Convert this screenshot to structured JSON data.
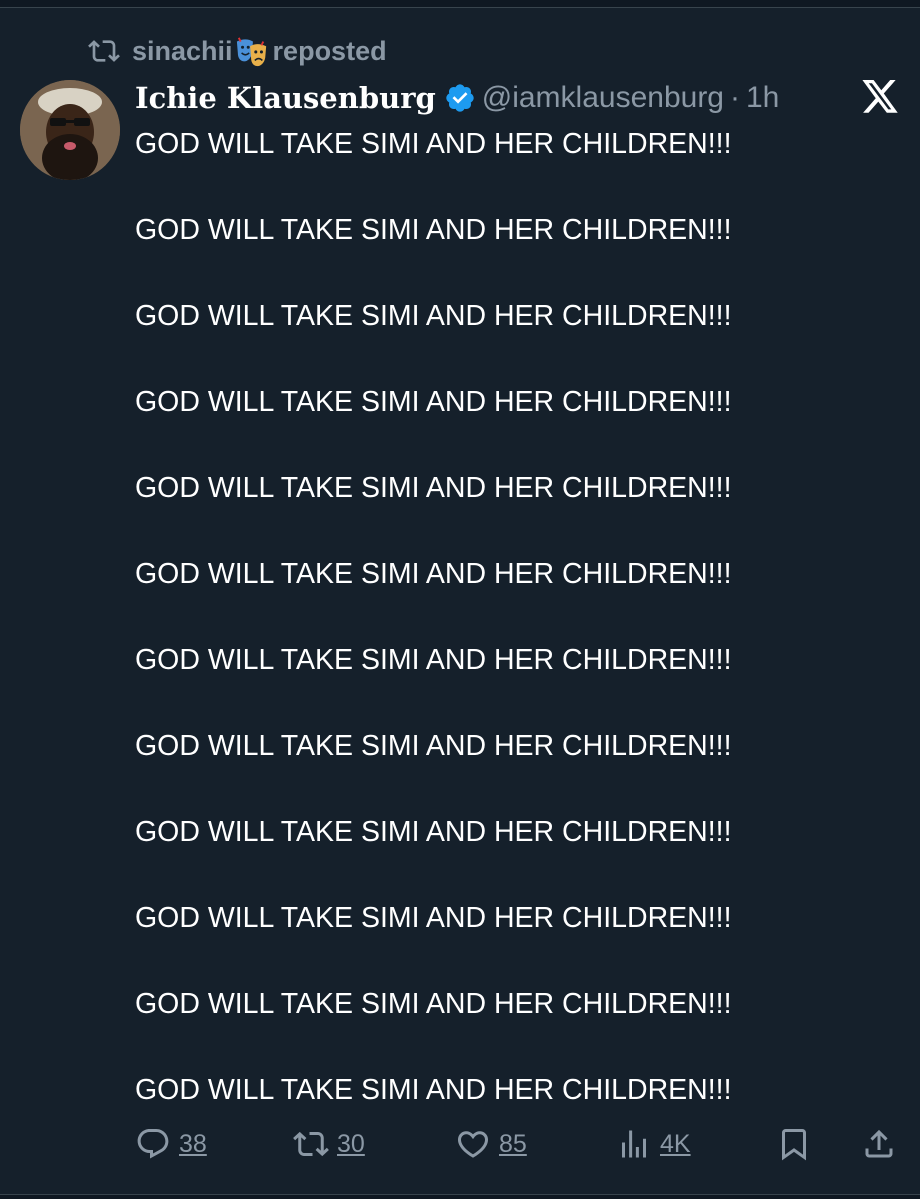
{
  "repost": {
    "reposter_name": "sinachii",
    "repost_label": "reposted",
    "mask_icon": "performing-arts-icon"
  },
  "tweet": {
    "display_name": "Ichie Klausenburg",
    "handle": "@iamklausenburg",
    "separator": "·",
    "time": "1h",
    "verified": true,
    "lines": [
      "GOD WILL TAKE SIMI AND HER CHILDREN!!!",
      "GOD WILL TAKE SIMI AND HER CHILDREN!!!",
      "GOD WILL TAKE SIMI AND HER CHILDREN!!!",
      "GOD WILL TAKE SIMI AND HER CHILDREN!!!",
      "GOD WILL TAKE SIMI AND HER CHILDREN!!!",
      "GOD WILL TAKE SIMI AND HER CHILDREN!!!",
      "GOD WILL TAKE SIMI AND HER CHILDREN!!!",
      "GOD WILL TAKE SIMI AND HER CHILDREN!!!",
      "GOD WILL TAKE SIMI AND HER CHILDREN!!!",
      "GOD WILL TAKE SIMI AND HER CHILDREN!!!",
      "GOD WILL TAKE SIMI AND HER CHILDREN!!!",
      "GOD WILL TAKE SIMI AND HER CHILDREN!!!"
    ]
  },
  "actions": {
    "replies": "38",
    "reposts": "30",
    "likes": "85",
    "views": "4K"
  },
  "icons": {
    "repost": "repost-icon",
    "verified": "verified-badge-icon",
    "x_logo": "x-logo-icon",
    "reply": "reply-icon",
    "retweet": "retweet-icon",
    "like": "heart-icon",
    "views": "views-chart-icon",
    "bookmark": "bookmark-icon",
    "share": "share-icon"
  },
  "colors": {
    "background": "#15202b",
    "text": "#ffffff",
    "secondary_text": "#8b98a5",
    "verified_blue": "#1d9bf0"
  }
}
